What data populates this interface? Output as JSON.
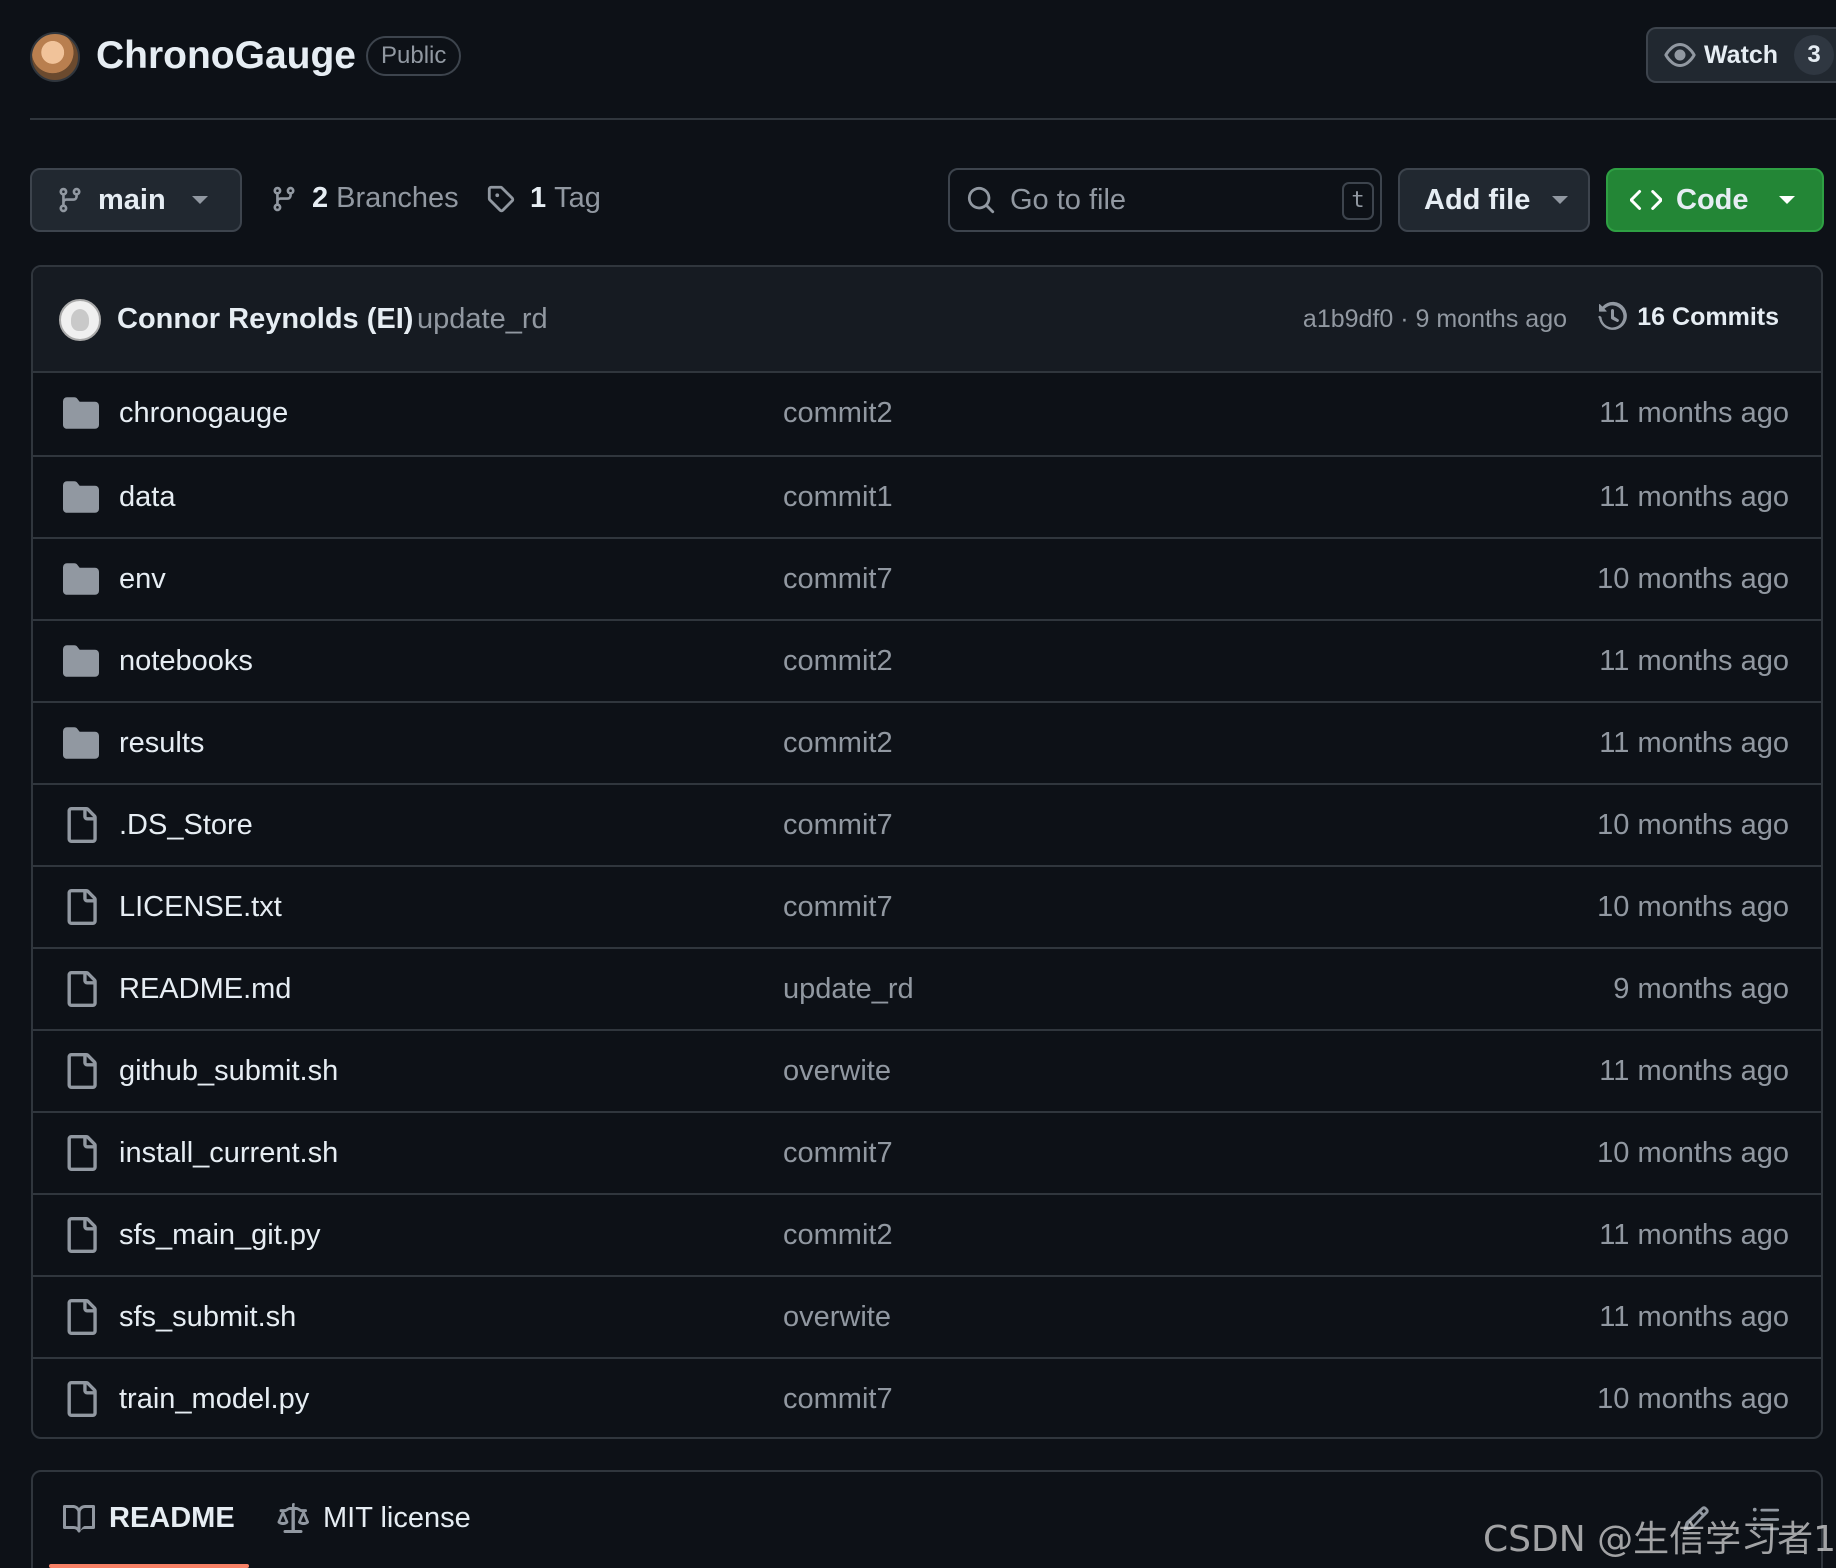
{
  "repo": {
    "name": "ChronoGauge",
    "visibility": "Public",
    "watch_label": "Watch",
    "watch_count": "3"
  },
  "toolbar": {
    "branch": "main",
    "branches_count": "2",
    "branches_label": "Branches",
    "tags_count": "1",
    "tags_label": "Tag",
    "search_placeholder": "Go to file",
    "search_shortcut": "t",
    "add_file_label": "Add file",
    "code_label": "Code"
  },
  "latest_commit": {
    "author": "Connor Reynolds (EI)",
    "message": "update_rd",
    "hash_time": "a1b9df0 · 9 months ago",
    "commits_label": "16 Commits"
  },
  "files": [
    {
      "type": "folder",
      "name": "chronogauge",
      "message": "commit2",
      "age": "11 months ago"
    },
    {
      "type": "folder",
      "name": "data",
      "message": "commit1",
      "age": "11 months ago"
    },
    {
      "type": "folder",
      "name": "env",
      "message": "commit7",
      "age": "10 months ago"
    },
    {
      "type": "folder",
      "name": "notebooks",
      "message": "commit2",
      "age": "11 months ago"
    },
    {
      "type": "folder",
      "name": "results",
      "message": "commit2",
      "age": "11 months ago"
    },
    {
      "type": "file",
      "name": ".DS_Store",
      "message": "commit7",
      "age": "10 months ago"
    },
    {
      "type": "file",
      "name": "LICENSE.txt",
      "message": "commit7",
      "age": "10 months ago"
    },
    {
      "type": "file",
      "name": "README.md",
      "message": "update_rd",
      "age": "9 months ago"
    },
    {
      "type": "file",
      "name": "github_submit.sh",
      "message": "overwite",
      "age": "11 months ago"
    },
    {
      "type": "file",
      "name": "install_current.sh",
      "message": "commit7",
      "age": "10 months ago"
    },
    {
      "type": "file",
      "name": "sfs_main_git.py",
      "message": "commit2",
      "age": "11 months ago"
    },
    {
      "type": "file",
      "name": "sfs_submit.sh",
      "message": "overwite",
      "age": "11 months ago"
    },
    {
      "type": "file",
      "name": "train_model.py",
      "message": "commit7",
      "age": "10 months ago"
    }
  ],
  "readme_tabs": {
    "readme": "README",
    "license": "MIT license"
  },
  "watermark": "CSDN @生信学习者1",
  "colors": {
    "background": "#0d1117",
    "border": "#30363d",
    "code_button": "#238636",
    "accent_underline": "#f78166"
  }
}
